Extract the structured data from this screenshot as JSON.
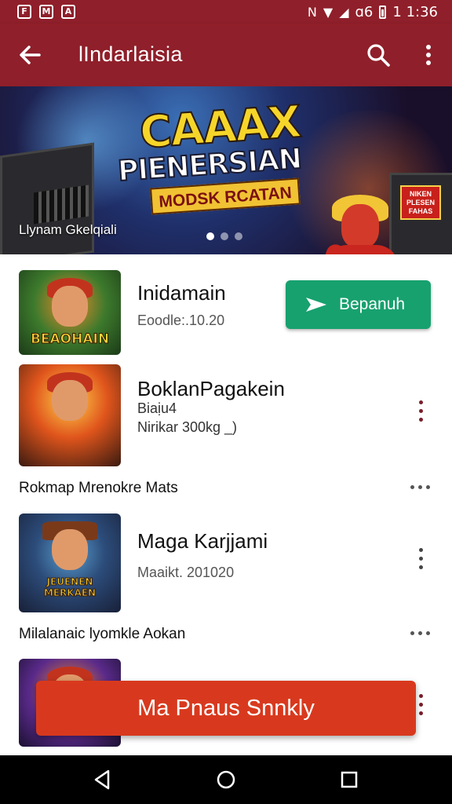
{
  "status_bar": {
    "notifications": [
      "F",
      "M",
      "A"
    ],
    "signal_text": "ɑ6",
    "time": "1 1:36"
  },
  "app_bar": {
    "title": "lIndarlaisia"
  },
  "banner": {
    "title_line1": "CAAAX",
    "title_line2": "PIENERSIAN",
    "title_line3": "MODSK RCATAN",
    "logo_text": "NIKEN PLESEN FAHAS",
    "caption": "Llynam Gkelqiali",
    "pages": 3,
    "active_page": 1
  },
  "list": {
    "items": [
      {
        "thumb_label": "BEAOHAIN",
        "title": "Inidamain",
        "subtitle": "Eoodle:.10.20",
        "action_label": "Bepanuh"
      },
      {
        "thumb_label": "",
        "title": "BoklanPagakein",
        "subtitle_1": "Biaịu4",
        "subtitle_2": "Nirikar 300kg _)",
        "group_caption": "Rokmap Mrenokre Mats"
      },
      {
        "thumb_label": "JEUENEN MERKAEN",
        "title": "Maga Karjjami",
        "subtitle": "Maaikt. 201020",
        "group_caption": "Milalanaic lyomkle Aokan"
      }
    ]
  },
  "cta": {
    "label": "Ma Pnaus Snnkly"
  },
  "colors": {
    "primary": "#8f1f2a",
    "install": "#17a16f",
    "cta": "#d8391e"
  },
  "icons": {
    "back": "arrow-left-icon",
    "search": "search-icon",
    "more": "more-vert-icon",
    "nav": [
      "back-triangle-icon",
      "home-circle-icon",
      "recents-square-icon"
    ]
  }
}
